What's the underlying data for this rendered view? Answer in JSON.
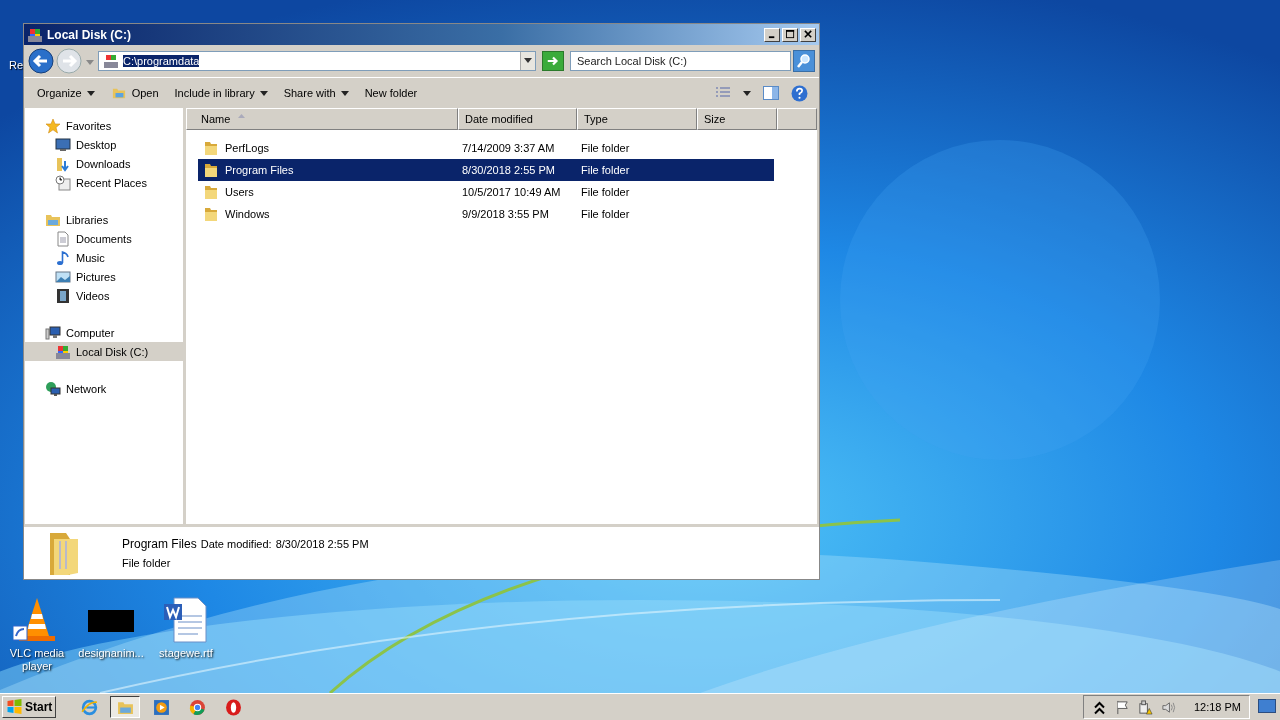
{
  "desktop": {
    "cut_label": "Re",
    "icons": [
      {
        "label": "VLC media player"
      },
      {
        "label": "designanim..."
      },
      {
        "label": "stagewe.rtf"
      }
    ]
  },
  "window": {
    "title": "Local Disk (C:)",
    "address": {
      "value": "C:\\programdata",
      "text_selected": true
    },
    "search": {
      "placeholder": "Search Local Disk (C:)"
    },
    "toolbar": [
      {
        "label": "Organize",
        "has_menu": true
      },
      {
        "label": "Open",
        "has_menu": false
      },
      {
        "label": "Include in library",
        "has_menu": true
      },
      {
        "label": "Share with",
        "has_menu": true
      },
      {
        "label": "New folder",
        "has_menu": false
      }
    ],
    "sidebar": [
      {
        "label": "Favorites",
        "selected": false,
        "children": [
          {
            "label": "Desktop",
            "selected": false
          },
          {
            "label": "Downloads",
            "selected": false
          },
          {
            "label": "Recent Places",
            "selected": false
          }
        ]
      },
      {
        "label": "Libraries",
        "selected": false,
        "children": [
          {
            "label": "Documents",
            "selected": false
          },
          {
            "label": "Music",
            "selected": false
          },
          {
            "label": "Pictures",
            "selected": false
          },
          {
            "label": "Videos",
            "selected": false
          }
        ]
      },
      {
        "label": "Computer",
        "selected": false,
        "children": [
          {
            "label": "Local Disk (C:)",
            "selected": true
          }
        ]
      },
      {
        "label": "Network",
        "selected": false
      }
    ],
    "table": {
      "columns": [
        {
          "label": "Name",
          "sorted": true
        },
        {
          "label": "Date modified",
          "sorted": false
        },
        {
          "label": "Type",
          "sorted": false
        },
        {
          "label": "Size",
          "sorted": false
        }
      ],
      "rows": [
        {
          "name": "PerfLogs",
          "date": "7/14/2009 3:37 AM",
          "type": "File folder",
          "selected": false
        },
        {
          "name": "Program Files",
          "date": "8/30/2018 2:55 PM",
          "type": "File folder",
          "selected": true
        },
        {
          "name": "Users",
          "date": "10/5/2017 10:49 AM",
          "type": "File folder",
          "selected": false
        },
        {
          "name": "Windows",
          "date": "9/9/2018 3:55 PM",
          "type": "File folder",
          "selected": false
        }
      ]
    },
    "details": {
      "name": "Program Files",
      "date_label": "Date modified:",
      "date": "8/30/2018 2:55 PM",
      "type": "File folder"
    }
  },
  "taskbar": {
    "start": "Start",
    "apps": [
      {
        "active": false
      },
      {
        "active": true
      },
      {
        "active": false
      },
      {
        "active": false
      },
      {
        "active": false
      }
    ],
    "clock": "12:18 PM"
  }
}
